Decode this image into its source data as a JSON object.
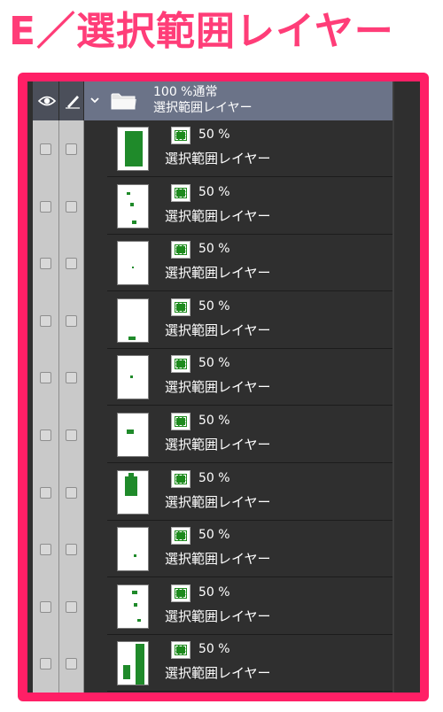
{
  "heading": "E／選択範囲レイヤー",
  "colors": {
    "accent": "#ff1f66",
    "panel": "#2f2f2f",
    "header": "#6b7388",
    "selection_green": "#1d8a1d"
  },
  "folder": {
    "opacity": "100 %通常",
    "name": "選択範囲レイヤー",
    "icons": [
      "eye-icon",
      "pen-icon",
      "chevron-down-icon",
      "folder-icon"
    ]
  },
  "layers": [
    {
      "opacity": "50 %",
      "name": "選択範囲レイヤー"
    },
    {
      "opacity": "50 %",
      "name": "選択範囲レイヤー"
    },
    {
      "opacity": "50 %",
      "name": "選択範囲レイヤー"
    },
    {
      "opacity": "50 %",
      "name": "選択範囲レイヤー"
    },
    {
      "opacity": "50 %",
      "name": "選択範囲レイヤー"
    },
    {
      "opacity": "50 %",
      "name": "選択範囲レイヤー"
    },
    {
      "opacity": "50 %",
      "name": "選択範囲レイヤー"
    },
    {
      "opacity": "50 %",
      "name": "選択範囲レイヤー"
    },
    {
      "opacity": "50 %",
      "name": "選択範囲レイヤー"
    },
    {
      "opacity": "50 %",
      "name": "選択範囲レイヤー"
    }
  ]
}
